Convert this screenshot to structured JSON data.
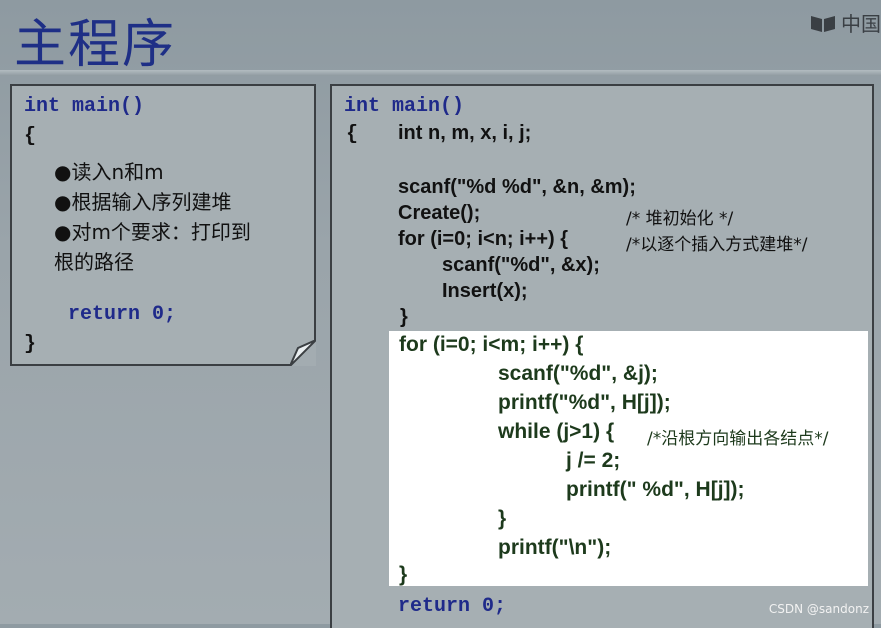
{
  "title": "主程序",
  "watermark_top": "中国",
  "left_panel": {
    "header": "int main()",
    "open_brace": "{",
    "bullets": [
      "●读入n和m",
      "●根据输入序列建堆",
      "●对m个要求：打印到",
      "根的路径"
    ],
    "return_stmt": "return 0;",
    "close_brace": "}"
  },
  "right_panel": {
    "header": "int main()",
    "open_brace": "{",
    "decl": "int n, m, x, i, j;",
    "scanf1": "scanf(\"%d %d\", &n, &m);",
    "create": "Create();",
    "create_comment": "/* 堆初始化 */",
    "for1": "for (i=0; i<n; i++) {",
    "for1_comment": "/*以逐个插入方式建堆*/",
    "scanf2": "scanf(\"%d\", &x);",
    "insert": "Insert(x);",
    "close1": "}",
    "return_stmt": "return 0;"
  },
  "highlight": {
    "for2": "for (i=0; i<m; i++) {",
    "scanf3": "scanf(\"%d\", &j);",
    "printf1": "printf(\"%d\", H[j]);",
    "while": "while (j>1) {",
    "while_comment": "/*沿根方向输出各结点*/",
    "div": "j /= 2;",
    "printf2": "printf(\" %d\", H[j]);",
    "close_while": "}",
    "printf3": "printf(\"\\n\");",
    "close_for": "}"
  },
  "footer_watermark": "CSDN @sandonz"
}
